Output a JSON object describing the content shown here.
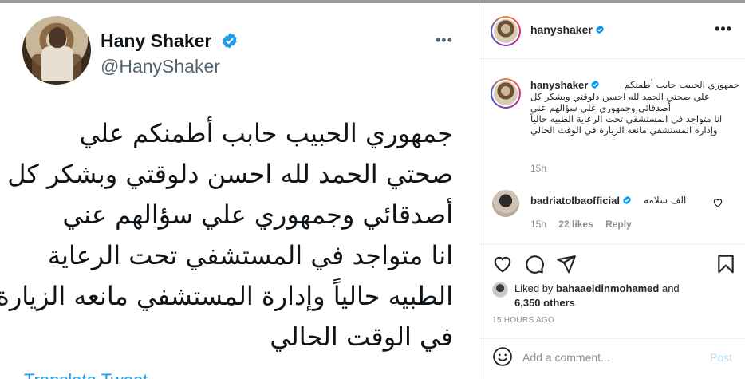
{
  "tweet": {
    "name": "Hany Shaker",
    "handle": "@HanyShaker",
    "more_icon": "ellipsis-icon",
    "lines": [
      "جمهوري الحبيب حابب أطمنكم  علي",
      "صحتي الحمد لله احسن دلوقتي وبشكر كل",
      "أصدقائي وجمهوري علي سؤالهم عني",
      "انا متواجد في المستشفي تحت الرعاية",
      "الطبيه حالياً  وإدارة المستشفي مانعه الزيارة",
      "في الوقت الحالي"
    ],
    "translate": "Translate Tweet",
    "verified_color": "#1d9bf0"
  },
  "post": {
    "username": "hanyshaker",
    "caption_lines": [
      "جمهوري الحبيب حابب أطمنكم",
      "علي صحتي الحمد لله احسن دلوقتي وبشكر كل",
      "أصدقائي وجمهوري علي سؤالهم عني",
      "انا متواجد في المستشفي تحت الرعاية الطبيه حالياً",
      "وإدارة المستشفي مانعه الزيارة في الوقت الحالي"
    ],
    "caption_time": "15h",
    "comment": {
      "username": "badriatolbaofficial",
      "text": "الف سلامه",
      "time": "15h",
      "likes": "22 likes",
      "reply": "Reply"
    },
    "liked_by_prefix": "Liked by ",
    "liked_by_user": "bahaaeldinmohamed",
    "liked_by_and": " and",
    "liked_by_others": "6,350 others",
    "time_ago": "15 HOURS AGO",
    "add_comment_placeholder": "Add a comment...",
    "post_button": "Post",
    "icons": [
      "heart-icon",
      "comment-icon",
      "share-icon",
      "bookmark-icon",
      "smiley-icon",
      "more-icon"
    ],
    "verified_color": "#0095f6"
  }
}
